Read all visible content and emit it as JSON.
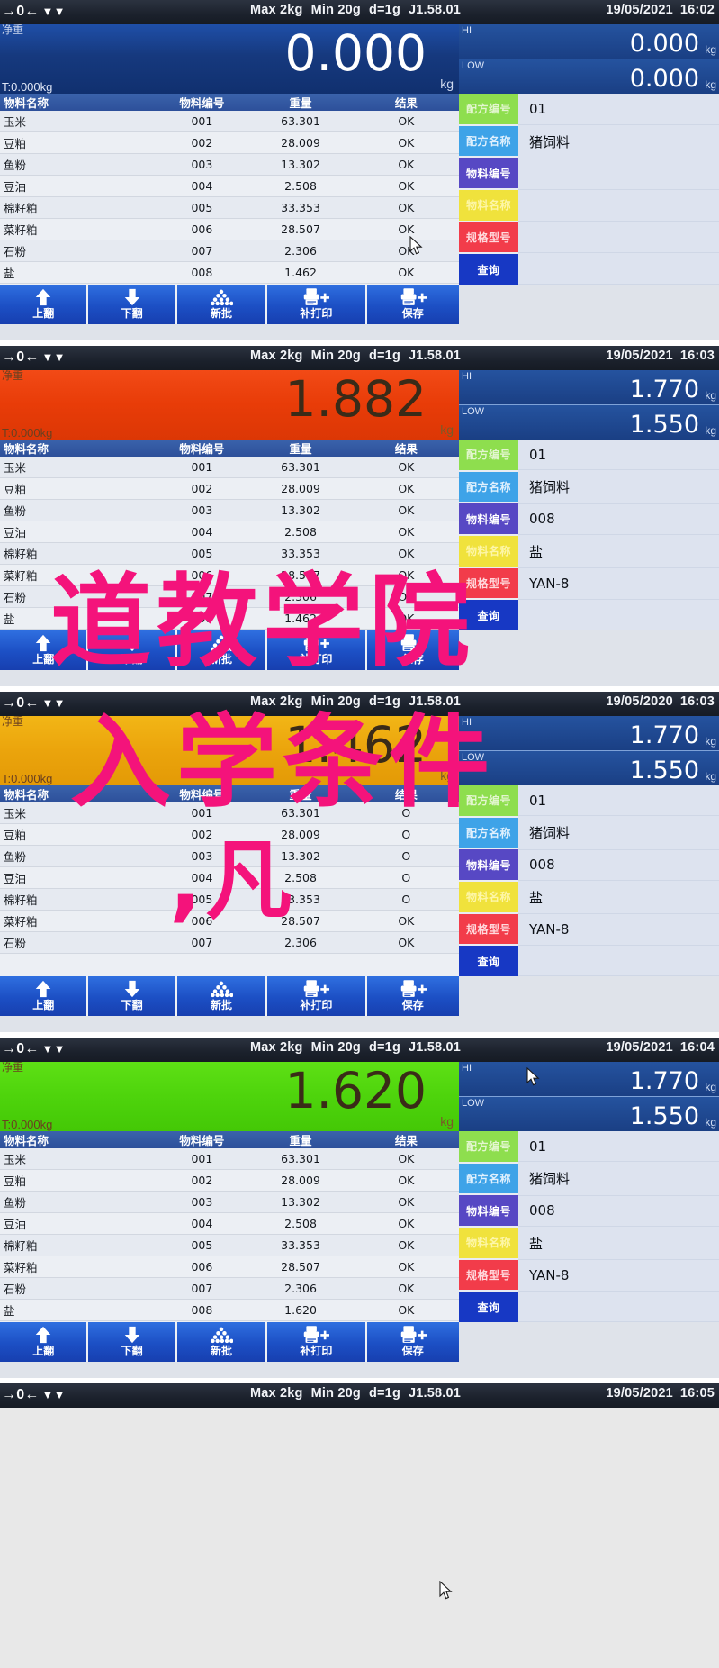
{
  "meta": {
    "device": "industrial-weighing-indicator",
    "overlay_text_lines": [
      "道教学院",
      "入学条件",
      ",凡"
    ]
  },
  "colors": {
    "accent_blue": "#1c4fc4",
    "panel_blue": "#16397e",
    "status_red": "#e83c08",
    "status_orange": "#eba40c",
    "status_green": "#4ed40c",
    "btn_green": "#8ede4e",
    "btn_blue": "#3ea3e8",
    "btn_purple": "#5748c4",
    "btn_yellow": "#f0e23c",
    "btn_red": "#f23c4a",
    "btn_navy": "#1738c4",
    "overlay_pink": "#f4137b"
  },
  "status_bar": {
    "max": "Max 2kg",
    "min": "Min 20g",
    "division": "d=1g",
    "version": "J1.58.01",
    "icons": [
      "zero-icon",
      "tare-arrow-icon",
      "stable-icon"
    ]
  },
  "labels": {
    "net": "净重",
    "tare_prefix": "T:",
    "unit": "kg",
    "hi": "HI",
    "low": "LOW"
  },
  "table": {
    "headers": [
      "物料名称",
      "物料编号",
      "重量",
      "结果"
    ]
  },
  "side_buttons": [
    {
      "name": "recipe-number",
      "label": "配方编号",
      "color": "green"
    },
    {
      "name": "recipe-name",
      "label": "配方名称",
      "color": "blue"
    },
    {
      "name": "material-number",
      "label": "物料编号",
      "color": "purple"
    },
    {
      "name": "material-name",
      "label": "物料名称",
      "color": "yellow"
    },
    {
      "name": "spec-model",
      "label": "规格型号",
      "color": "red"
    },
    {
      "name": "query",
      "label": "查询",
      "color": "navy"
    }
  ],
  "toolbar": [
    {
      "name": "page-up",
      "label": "上翻",
      "icon": "arrow-up-icon"
    },
    {
      "name": "page-down",
      "label": "下翻",
      "icon": "arrow-down-icon"
    },
    {
      "name": "new-batch",
      "label": "新批",
      "icon": "stack-icon"
    },
    {
      "name": "reprint",
      "label": "补打印",
      "icon": "printer-plus-icon"
    },
    {
      "name": "save",
      "label": "保存",
      "icon": "printer-plus-icon"
    }
  ],
  "panels": [
    {
      "id": "panel-1",
      "date": "19/05/2021",
      "time": "16:02",
      "weight": "0.000",
      "weight_color": "blue",
      "tare": "T:0.000kg",
      "hi": "0.000",
      "low": "0.000",
      "rows": [
        {
          "name": "玉米",
          "no": "001",
          "weight": "63.301",
          "result": "OK"
        },
        {
          "name": "豆粕",
          "no": "002",
          "weight": "28.009",
          "result": "OK"
        },
        {
          "name": "鱼粉",
          "no": "003",
          "weight": "13.302",
          "result": "OK"
        },
        {
          "name": "豆油",
          "no": "004",
          "weight": "2.508",
          "result": "OK"
        },
        {
          "name": "棉籽粕",
          "no": "005",
          "weight": "33.353",
          "result": "OK"
        },
        {
          "name": "菜籽粕",
          "no": "006",
          "weight": "28.507",
          "result": "OK"
        },
        {
          "name": "石粉",
          "no": "007",
          "weight": "2.306",
          "result": "OK"
        },
        {
          "name": "盐",
          "no": "008",
          "weight": "1.462",
          "result": "OK"
        }
      ],
      "side_values": [
        "01",
        "猪饲料",
        "",
        "",
        ""
      ]
    },
    {
      "id": "panel-2",
      "date": "19/05/2021",
      "time": "16:03",
      "weight": "1.882",
      "weight_color": "red",
      "tare": "T:0.000kg",
      "hi": "1.770",
      "low": "1.550",
      "rows": [
        {
          "name": "玉米",
          "no": "001",
          "weight": "63.301",
          "result": "OK"
        },
        {
          "name": "豆粕",
          "no": "002",
          "weight": "28.009",
          "result": "OK"
        },
        {
          "name": "鱼粉",
          "no": "003",
          "weight": "13.302",
          "result": "OK"
        },
        {
          "name": "豆油",
          "no": "004",
          "weight": "2.508",
          "result": "OK"
        },
        {
          "name": "棉籽粕",
          "no": "005",
          "weight": "33.353",
          "result": "OK"
        },
        {
          "name": "菜籽粕",
          "no": "006",
          "weight": "28.507",
          "result": "OK"
        },
        {
          "name": "石粉",
          "no": "007",
          "weight": "2.306",
          "result": "OK"
        },
        {
          "name": "盐",
          "no": "008",
          "weight": "1.462",
          "result": "OK"
        }
      ],
      "side_values": [
        "01",
        "猪饲料",
        "008",
        "盐",
        "YAN-8"
      ]
    },
    {
      "id": "panel-3",
      "date": "19/05/2020",
      "time": "16:03",
      "weight": "1.462",
      "weight_color": "orange",
      "tare": "T:0.000kg",
      "hi": "1.770",
      "low": "1.550",
      "rows": [
        {
          "name": "玉米",
          "no": "001",
          "weight": "63.301",
          "result": "O"
        },
        {
          "name": "豆粕",
          "no": "002",
          "weight": "28.009",
          "result": "O"
        },
        {
          "name": "鱼粉",
          "no": "003",
          "weight": "13.302",
          "result": "O"
        },
        {
          "name": "豆油",
          "no": "004",
          "weight": "2.508",
          "result": "O"
        },
        {
          "name": "棉籽粕",
          "no": "005",
          "weight": "33.353",
          "result": "O"
        },
        {
          "name": "菜籽粕",
          "no": "006",
          "weight": "28.507",
          "result": "OK"
        },
        {
          "name": "石粉",
          "no": "007",
          "weight": "2.306",
          "result": "OK"
        },
        {
          "name": "",
          "no": "",
          "weight": "",
          "result": ""
        }
      ],
      "side_values": [
        "01",
        "猪饲料",
        "008",
        "盐",
        "YAN-8"
      ]
    },
    {
      "id": "panel-4",
      "date": "19/05/2021",
      "time": "16:04",
      "weight": "1.620",
      "weight_color": "green",
      "tare": "T:0.000kg",
      "hi": "1.770",
      "low": "1.550",
      "rows": [
        {
          "name": "玉米",
          "no": "001",
          "weight": "63.301",
          "result": "OK"
        },
        {
          "name": "豆粕",
          "no": "002",
          "weight": "28.009",
          "result": "OK"
        },
        {
          "name": "鱼粉",
          "no": "003",
          "weight": "13.302",
          "result": "OK"
        },
        {
          "name": "豆油",
          "no": "004",
          "weight": "2.508",
          "result": "OK"
        },
        {
          "name": "棉籽粕",
          "no": "005",
          "weight": "33.353",
          "result": "OK"
        },
        {
          "name": "菜籽粕",
          "no": "006",
          "weight": "28.507",
          "result": "OK"
        },
        {
          "name": "石粉",
          "no": "007",
          "weight": "2.306",
          "result": "OK"
        },
        {
          "name": "盐",
          "no": "008",
          "weight": "1.620",
          "result": "OK"
        }
      ],
      "side_values": [
        "01",
        "猪饲料",
        "008",
        "盐",
        "YAN-8"
      ]
    },
    {
      "id": "panel-5",
      "date": "19/05/2021",
      "time": "16:05",
      "weight": "",
      "weight_color": "blue",
      "tare": "",
      "hi": "",
      "low": "",
      "rows": [],
      "side_values": []
    }
  ]
}
